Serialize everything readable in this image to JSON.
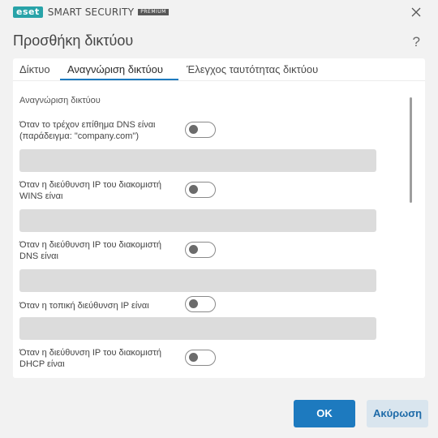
{
  "app": {
    "logo_brand": "eset",
    "logo_product": "SMART SECURITY",
    "logo_edition": "PREMIUM"
  },
  "dialog": {
    "title": "Προσθήκη δικτύου",
    "help": "?"
  },
  "tabs": [
    {
      "label": "Δίκτυο",
      "active": false
    },
    {
      "label": "Αναγνώριση δικτύου",
      "active": true
    },
    {
      "label": "Έλεγχος ταυτότητας δικτύου",
      "active": false
    }
  ],
  "identification": {
    "section_title": "Αναγνώριση δικτύου",
    "rows": [
      {
        "label": "Όταν το τρέχον επίθημα DNS είναι (παράδειγμα: \"company.com\")",
        "enabled": false,
        "value": ""
      },
      {
        "label": "Όταν η διεύθυνση IP του διακομιστή WINS είναι",
        "enabled": false,
        "value": ""
      },
      {
        "label": "Όταν η διεύθυνση IP του διακομιστή DNS είναι",
        "enabled": false,
        "value": ""
      },
      {
        "label": "Όταν η τοπική διεύθυνση IP είναι",
        "enabled": false,
        "value": ""
      },
      {
        "label": "Όταν η διεύθυνση IP του διακομιστή DHCP είναι",
        "enabled": false,
        "value": ""
      }
    ]
  },
  "buttons": {
    "ok": "OK",
    "cancel": "Ακύρωση"
  },
  "colors": {
    "brand": "#28a3a8",
    "accent": "#1d7abf",
    "cancel_bg": "#d9e5ee",
    "field_bg": "#dcdcdc"
  }
}
